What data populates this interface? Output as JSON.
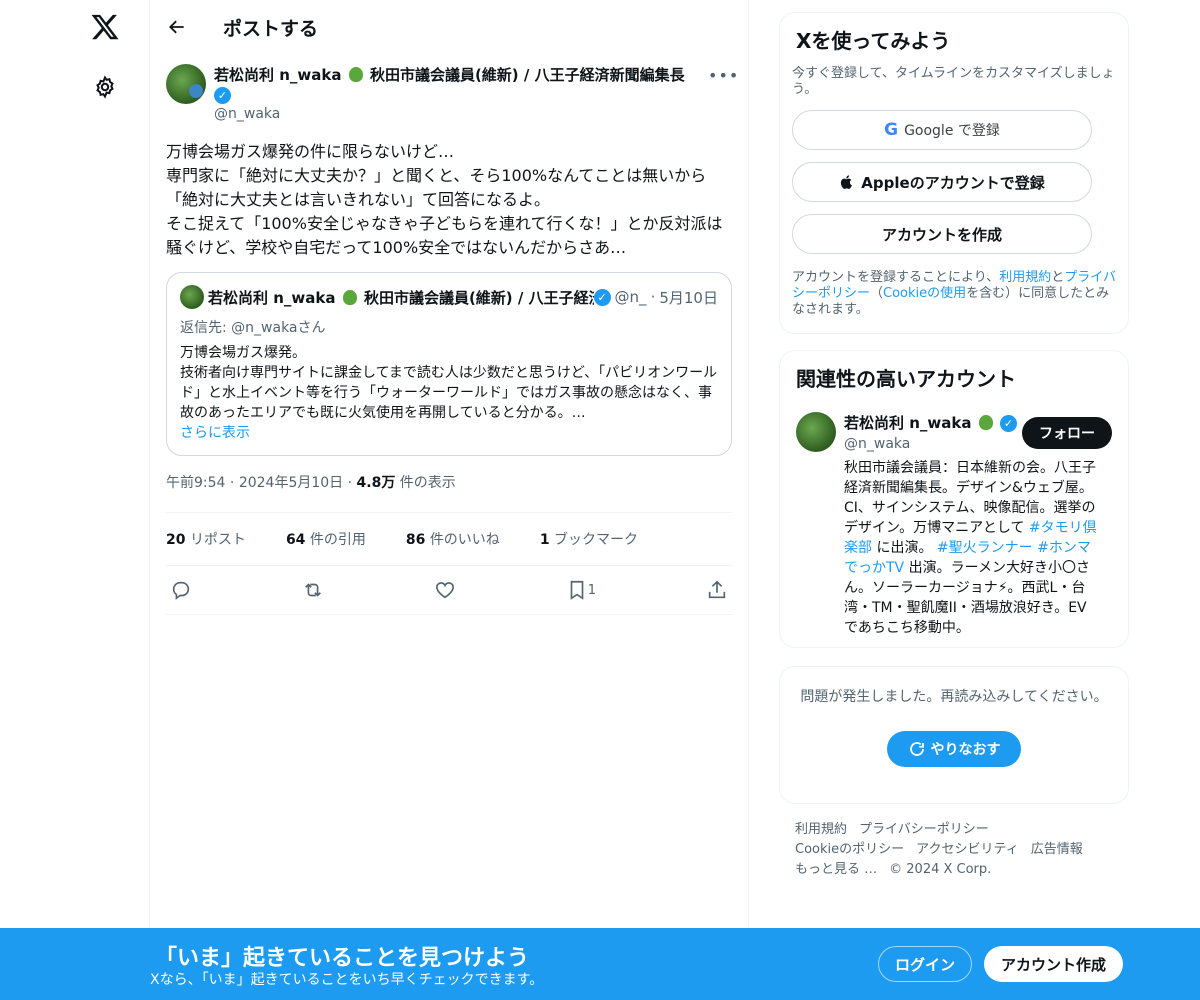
{
  "header": {
    "title": "ポストする"
  },
  "tweet": {
    "author_name": "若松尚利 n_waka",
    "author_suffix": "秋田市議会議員(維新) / 八王子経済新聞編集長 / ",
    "handle": "@n_waka",
    "more": "•••",
    "text": "万博会場ガス爆発の件に限らないけど…\n専門家に「絶対に大丈夫か？」と聞くと、そら100%なんてことは無いから「絶対に大丈夫とは言いきれない」て回答になるよ。\nそこ捉えて「100%安全じゃなきゃ子どもらを連れて行くな！」とか反対派は騒ぐけど、学校や自宅だって100%安全ではないんだからさあ…",
    "quote": {
      "author_name": "若松尚利 n_waka",
      "author_suffix": "秋田市議会議員(維新) / 八王子経済新",
      "handle": "@n_",
      "date": "5月10日",
      "reply_to": "返信先: @n_wakaさん",
      "text": "万博会場ガス爆発。\n技術者向け専門サイトに課金してまで読む人は少数だと思うけど、「パビリオンワールド」と水上イベント等を行う「ウォーターワールド」ではガス事故の懸念はなく、事故のあったエリアでも既に火気使用を再開していると分かる。…",
      "show_more": "さらに表示"
    },
    "time": "午前9:54",
    "date": "2024年5月10日",
    "views_count": "4.8万",
    "views_label": "件の表示",
    "stats": {
      "reposts_count": "20",
      "reposts_label": "リポスト",
      "quotes_count": "64",
      "quotes_label": "件の引用",
      "likes_count": "86",
      "likes_label": "件のいいね",
      "bookmarks_count": "1",
      "bookmarks_label": "ブックマーク"
    },
    "bookmark_action_count": "1"
  },
  "signup": {
    "title": "Xを使ってみよう",
    "subtitle": "今すぐ登録して、タイムラインをカスタマイズしましょう。",
    "google_label": "Google で登録",
    "apple_label": "Appleのアカウントで登録",
    "create_label": "アカウントを作成",
    "terms_pre": "アカウントを登録することにより、",
    "terms_link": "利用規約",
    "terms_and": "と",
    "privacy_link": "プライバシーポリシー",
    "terms_mid": "（",
    "cookie_link": "Cookieの使用",
    "terms_post": "を含む）に同意したとみなされます。"
  },
  "relevant": {
    "title": "関連性の高いアカウント",
    "name": "若松尚利 n_waka",
    "handle": "@n_waka",
    "follow_label": "フォロー",
    "bio_1": "秋田市議会議員：日本維新の会。八王子経済新聞編集長。デザイン&ウェブ屋。CI、サインシステム、映像配信。選挙のデザイン。万博マニアとして ",
    "tag_1": "#タモリ倶楽部",
    "bio_2": " に出演。 ",
    "tag_2": "#聖火ランナー",
    "bio_3": " ",
    "tag_3": "#ホンマでっかTV",
    "bio_4": " 出演。ラーメン大好き小〇さん。ソーラーカージョナ⚡。西武L・台湾・TM・聖飢魔II・酒場放浪好き。EVであちこち移動中。"
  },
  "error_card": {
    "message": "問題が発生しました。再読み込みしてください。",
    "retry_label": "やりなおす"
  },
  "footer": {
    "terms": "利用規約",
    "privacy": "プライバシーポリシー",
    "cookie": "Cookieのポリシー",
    "accessibility": "アクセシビリティ",
    "ads": "広告情報",
    "more": "もっと見る …",
    "copyright": "© 2024 X Corp."
  },
  "banner": {
    "title": "「いま」起きていることを見つけよう",
    "subtitle": "Xなら、「いま」起きていることをいち早くチェックできます。",
    "login_label": "ログイン",
    "signup_label": "アカウント作成"
  },
  "colors": {
    "accent": "#1d9bf0",
    "text": "#0f1419",
    "muted": "#536471"
  }
}
